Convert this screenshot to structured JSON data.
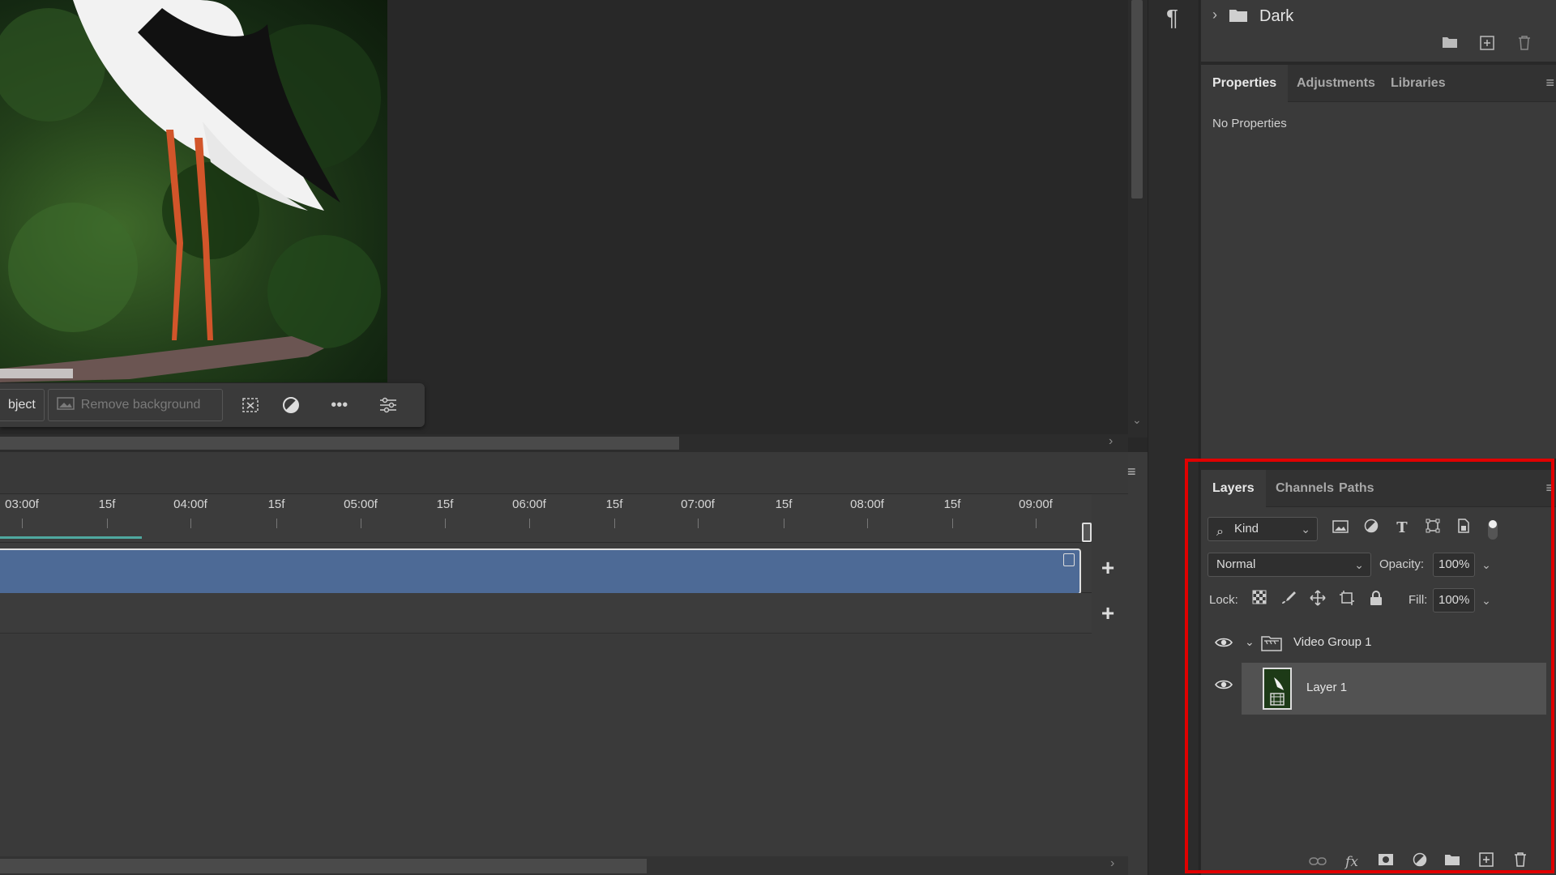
{
  "task_bar": {
    "select_subject_label": "bject",
    "remove_background_label": "Remove background"
  },
  "timeline": {
    "ruler_labels": [
      "03:00f",
      "15f",
      "04:00f",
      "15f",
      "05:00f",
      "15f",
      "06:00f",
      "15f",
      "07:00f",
      "15f",
      "08:00f",
      "15f",
      "09:00f"
    ],
    "add_track_label": "+"
  },
  "swatches": {
    "folder_label": "Dark"
  },
  "properties_panel": {
    "tabs": [
      "Properties",
      "Adjustments",
      "Libraries"
    ],
    "active_tab": "Properties",
    "message": "No Properties"
  },
  "layers_panel": {
    "tabs": [
      "Layers",
      "Channels",
      "Paths"
    ],
    "active_tab": "Layers",
    "filter_kind": "Kind",
    "blend_mode": "Normal",
    "opacity_label": "Opacity:",
    "opacity_value": "100%",
    "lock_label": "Lock:",
    "fill_label": "Fill:",
    "fill_value": "100%",
    "layers": [
      {
        "name": "Video Group 1",
        "type": "video-group",
        "visible": true,
        "expanded": true
      },
      {
        "name": "Layer 1",
        "type": "video-layer",
        "visible": true,
        "selected": true
      }
    ]
  },
  "colors": {
    "highlight": "#e00000",
    "clip": "#4d6a96",
    "panel_bg": "#3a3a3a"
  }
}
